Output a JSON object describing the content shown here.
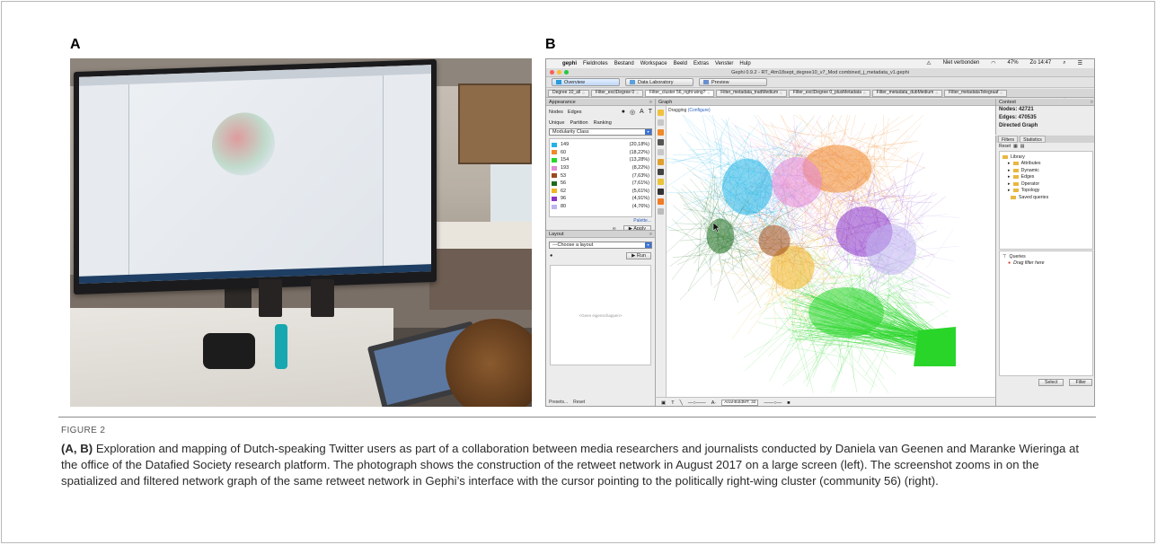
{
  "panel_labels": {
    "a": "A",
    "b": "B"
  },
  "gephi": {
    "menubar": {
      "app": "gephi",
      "items": [
        "Fieldnotes",
        "Bestand",
        "Workspace",
        "Beeld",
        "Extras",
        "Venster",
        "Hulp"
      ],
      "status": "Niet verbonden",
      "battery": "47%",
      "clock": "Zo 14:47"
    },
    "window_title": "Gephi 0.9.2 - RT_4tm18sept_degree10_v7_Mod combined_j_metadata_v1.gephi",
    "modes": [
      "Overview",
      "Data Laboratory",
      "Preview"
    ],
    "workspace_tabs": [
      "Degree 10_all",
      "Filter_exclDegree 0",
      "Filter_cluster 56_right wing?",
      "Filter_metadata_tradMedium",
      "Filter_exclDegree 0_plusMetadata",
      "Filter_metadata_dubMedium",
      "Filter_metadataTelegraaf"
    ],
    "appearance": {
      "title": "Appearance",
      "tabs": [
        "Nodes",
        "Edges"
      ],
      "subtabs": [
        "Unique",
        "Partition",
        "Ranking"
      ],
      "attribute": "Modularity Class",
      "partitions": [
        {
          "id": "149",
          "pct": "(20,18%)",
          "color": "#20b4e6"
        },
        {
          "id": "60",
          "pct": "(18,22%)",
          "color": "#f0892a"
        },
        {
          "id": "154",
          "pct": "(13,28%)",
          "color": "#2ad52a"
        },
        {
          "id": "193",
          "pct": "(8,22%)",
          "color": "#e389d8"
        },
        {
          "id": "53",
          "pct": "(7,63%)",
          "color": "#9c4a1c"
        },
        {
          "id": "56",
          "pct": "(7,61%)",
          "color": "#1b6b1b"
        },
        {
          "id": "62",
          "pct": "(5,61%)",
          "color": "#f0b424"
        },
        {
          "id": "96",
          "pct": "(4,91%)",
          "color": "#8a35c8"
        },
        {
          "id": "80",
          "pct": "(4,76%)",
          "color": "#bfb3f0"
        }
      ],
      "palette": "Palette...",
      "apply": "Apply"
    },
    "layout": {
      "title": "Layout",
      "choose": "---Choose a layout",
      "run": "Run",
      "empty": "<Geen eigenschappen>",
      "presets": "Presets...",
      "reset": "Reset"
    },
    "graph": {
      "title": "Graph",
      "dragging": "Dragging",
      "configure": "(Configure)",
      "font": "Arial-BoldMT, 32"
    },
    "context": {
      "title": "Context",
      "nodes": "Nodes: 42721",
      "edges": "Edges: 470535",
      "type": "Directed Graph"
    },
    "filters": {
      "tabs": [
        "Filters",
        "Statistics"
      ],
      "reset": "Reset",
      "library": "Library",
      "categories": [
        "Attributes",
        "Dynamic",
        "Edges",
        "Operator",
        "Topology",
        "Saved queries"
      ],
      "queries": "Queries",
      "drag_hint": "Drag filter here",
      "select": "Select",
      "filter": "Filter"
    }
  },
  "figure_label": "FIGURE 2",
  "caption": {
    "bold": "(A, B)",
    "text": " Exploration and mapping of Dutch-speaking Twitter users as part of a collaboration between media researchers and journalists conducted by Daniela van Geenen and Maranke Wieringa at the office of the Datafied Society research platform. The photograph shows the construction of the retweet network in August 2017 on a large screen (left). The screenshot zooms in on the spatialized and filtered network graph of the same retweet network in Gephi’s interface with the cursor pointing to the politically right-wing cluster (community 56) (right)."
  }
}
